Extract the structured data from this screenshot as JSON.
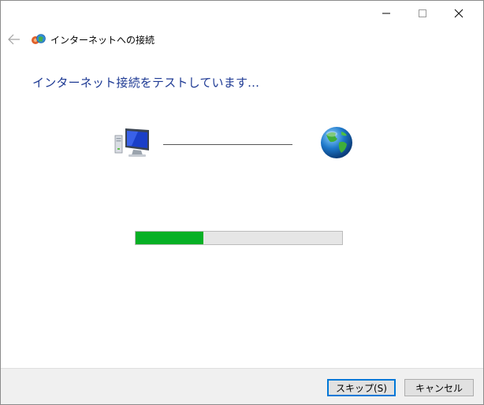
{
  "window": {
    "title": "インターネットへの接続",
    "controls": [
      "minimize-icon",
      "maximize-icon",
      "close-icon"
    ]
  },
  "nav": {
    "back_icon": "back-arrow-icon"
  },
  "main": {
    "heading": "インターネット接続をテストしています...",
    "left_icon": "computer-icon",
    "right_icon": "globe-icon",
    "progress_percent": 33
  },
  "footer": {
    "skip_label": "スキップ(S)",
    "cancel_label": "キャンセル"
  },
  "colors": {
    "heading": "#1e3a94",
    "progress_fill": "#06b025",
    "progress_track": "#e6e6e6",
    "default_button_border": "#0078d7"
  }
}
